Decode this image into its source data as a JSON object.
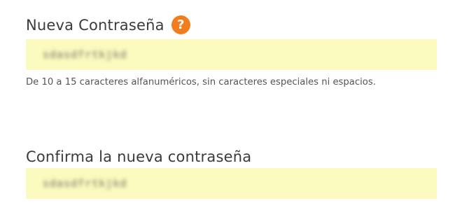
{
  "new_password": {
    "label": "Nueva Contraseña",
    "help_icon": "question-mark-icon",
    "help_glyph": "?",
    "value_masked": "sdasdfrtkjkd",
    "hint": "De 10 a 15 caracteres alfanuméricos, sin caracteres especiales ni espacios."
  },
  "confirm_password": {
    "label": "Confirma la nueva contraseña",
    "value_masked": "sdasdfrtkjkd"
  },
  "colors": {
    "input_background": "#fbfbbf",
    "help_icon": "#f07d1e",
    "label_text": "#3b3b3b"
  }
}
